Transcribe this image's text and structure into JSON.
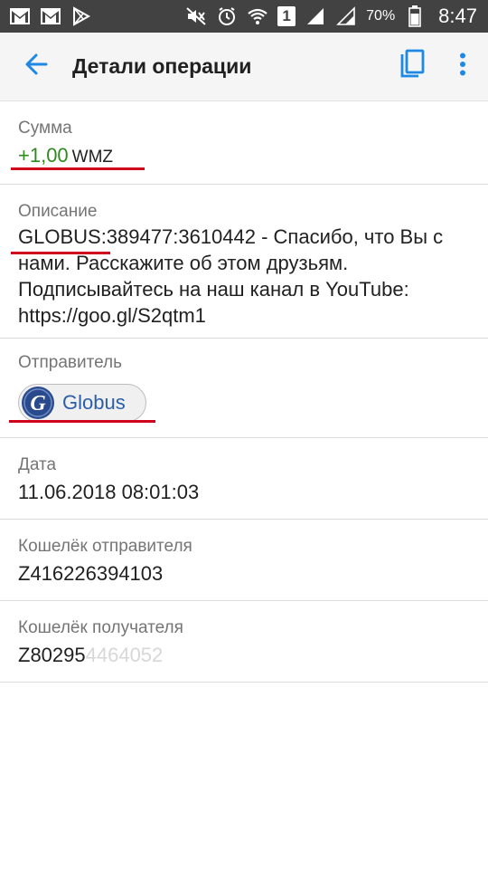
{
  "status_bar": {
    "sim_slot": "1",
    "battery_percent": "70%",
    "time": "8:47"
  },
  "app_bar": {
    "title": "Детали операции",
    "icons": {
      "back": "arrow-back-icon",
      "copy": "copy-icon",
      "menu": "more-vert-icon"
    }
  },
  "amount": {
    "label": "Сумма",
    "value": "+1,00",
    "currency": "WMZ",
    "value_color": "#2e8b1e"
  },
  "description": {
    "label": "Описание",
    "text": "GLOBUS:389477:3610442 - Спасибо, что Вы с нами. Расскажите об этом друзьям. Подписывайтесь на наш канал в YouTube: https://goo.gl/S2qtm1"
  },
  "sender": {
    "label": "Отправитель",
    "name": "Globus",
    "avatar_letter": "G"
  },
  "date": {
    "label": "Дата",
    "value": "11.06.2018 08:01:03"
  },
  "sender_wallet": {
    "label": "Кошелёк отправителя",
    "value": "Z416226394103"
  },
  "receiver_wallet": {
    "label": "Кошелёк получателя",
    "value_visible": "Z80295",
    "value_obscured": "4464052"
  },
  "colors": {
    "status_bar": "#424242",
    "app_bar": "#f5f5f5",
    "accent": "#1e88e5",
    "annotation_red": "#d0021b",
    "chip_text": "#2a5ea8"
  }
}
